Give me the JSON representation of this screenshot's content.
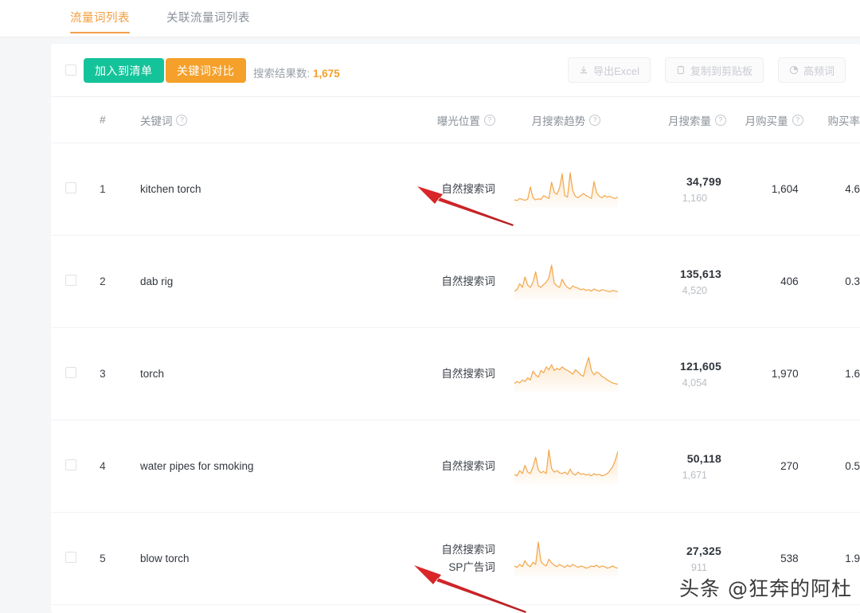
{
  "tabs": [
    {
      "label": "流量词列表",
      "active": true
    },
    {
      "label": "关联流量词列表",
      "active": false
    }
  ],
  "toolbar": {
    "add_to_list_label": "加入到清单",
    "compare_label": "关键词对比",
    "result_prefix": "搜索结果数:",
    "result_count": "1,675",
    "export_excel_label": "导出Excel",
    "copy_clipboard_label": "复制到剪贴板",
    "high_freq_label": "高频词",
    "export_icon": "download-icon",
    "copy_icon": "clipboard-icon",
    "high_freq_icon": "pie-chart-icon"
  },
  "table": {
    "headers": {
      "index": "#",
      "keyword": "关键词",
      "position": "曝光位置",
      "trend": "月搜索趋势",
      "volume": "月搜索量",
      "purchases": "月购买量",
      "rate": "购买率"
    },
    "rows": [
      {
        "index": "1",
        "keyword": "kitchen torch",
        "positions": [
          "自然搜索词"
        ],
        "volume_main": "34,799",
        "volume_sub": "1,160",
        "purchases": "1,604",
        "rate": "4.6",
        "trend": [
          18,
          16,
          22,
          19,
          17,
          20,
          55,
          24,
          18,
          21,
          19,
          30,
          26,
          22,
          68,
          40,
          34,
          52,
          92,
          30,
          26,
          95,
          44,
          28,
          24,
          30,
          36,
          30,
          26,
          22,
          70,
          38,
          28,
          24,
          30,
          26,
          28,
          24,
          22,
          26
        ]
      },
      {
        "index": "2",
        "keyword": "dab rig",
        "positions": [
          "自然搜索词"
        ],
        "volume_main": "135,613",
        "volume_sub": "4,520",
        "purchases": "406",
        "rate": "0.3",
        "trend": [
          20,
          24,
          40,
          30,
          58,
          36,
          30,
          44,
          72,
          34,
          30,
          38,
          44,
          56,
          90,
          42,
          34,
          30,
          52,
          38,
          30,
          26,
          34,
          30,
          28,
          24,
          26,
          22,
          24,
          20,
          26,
          22,
          20,
          24,
          22,
          20,
          18,
          22,
          20,
          18
        ]
      },
      {
        "index": "3",
        "keyword": "torch",
        "positions": [
          "自然搜索词"
        ],
        "volume_main": "121,605",
        "volume_sub": "4,054",
        "purchases": "1,970",
        "rate": "1.6",
        "trend": [
          20,
          26,
          22,
          30,
          26,
          36,
          30,
          54,
          44,
          38,
          56,
          50,
          66,
          58,
          72,
          56,
          62,
          58,
          66,
          60,
          56,
          52,
          46,
          58,
          52,
          44,
          40,
          70,
          92,
          56,
          44,
          52,
          48,
          40,
          36,
          30,
          26,
          22,
          20,
          18
        ]
      },
      {
        "index": "4",
        "keyword": "water pipes for smoking",
        "positions": [
          "自然搜索词"
        ],
        "volume_main": "50,118",
        "volume_sub": "1,671",
        "purchases": "270",
        "rate": "0.5",
        "trend": [
          24,
          20,
          34,
          26,
          48,
          30,
          26,
          44,
          70,
          36,
          28,
          32,
          26,
          90,
          40,
          30,
          34,
          28,
          26,
          30,
          24,
          38,
          26,
          22,
          30,
          24,
          26,
          22,
          24,
          20,
          26,
          22,
          24,
          20,
          22,
          26,
          34,
          44,
          62,
          86
        ]
      },
      {
        "index": "5",
        "keyword": "blow torch",
        "positions": [
          "自然搜索词",
          "SP广告词"
        ],
        "volume_main": "27,325",
        "volume_sub": "911",
        "purchases": "538",
        "rate": "1.9",
        "trend": [
          26,
          22,
          30,
          24,
          40,
          28,
          24,
          36,
          30,
          90,
          38,
          30,
          26,
          44,
          34,
          28,
          24,
          30,
          26,
          22,
          28,
          24,
          30,
          26,
          22,
          26,
          24,
          20,
          22,
          26,
          24,
          28,
          22,
          26,
          24,
          20,
          22,
          26,
          22,
          20
        ]
      }
    ]
  },
  "annotations": {
    "arrow_color": "#e0272a",
    "watermark": "头条 @狂奔的阿杜"
  },
  "colors": {
    "accent_orange": "#f5a02a",
    "accent_teal": "#15c39a",
    "spark_line": "#f3a64a",
    "text_primary": "#32373e",
    "text_muted": "#8b9199"
  }
}
